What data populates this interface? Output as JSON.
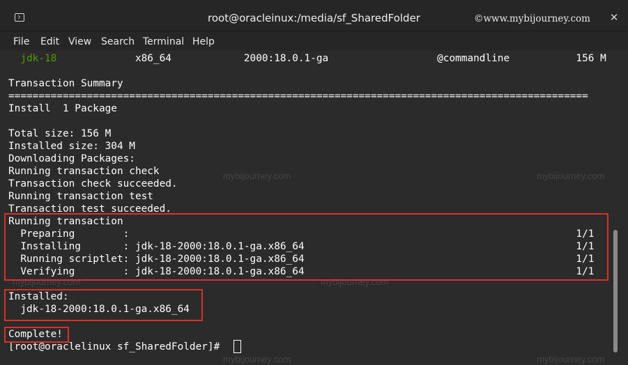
{
  "window": {
    "title": "root@oracleinux:/media/sf_SharedFolder",
    "watermark": "©www.mybijourney.com"
  },
  "menu": [
    "File",
    "Edit",
    "View",
    "Search",
    "Terminal",
    "Help"
  ],
  "terminal": {
    "lines": [
      "  jdk-18             x86_64            2000:18.0.1-ga                  @commandline           156 M",
      "",
      "Transaction Summary",
      "================================================================================================",
      "Install  1 Package",
      "",
      "Total size: 156 M",
      "Installed size: 304 M",
      "Downloading Packages:",
      "Running transaction check",
      "Transaction check succeeded.",
      "Running transaction test",
      "Transaction test succeeded.",
      "Running transaction",
      "  Preparing        :                                                                          1/1",
      "  Installing       : jdk-18-2000:18.0.1-ga.x86_64                                             1/1",
      "  Running scriptlet: jdk-18-2000:18.0.1-ga.x86_64                                             1/1",
      "  Verifying        : jdk-18-2000:18.0.1-ga.x86_64                                             1/1",
      "",
      "Installed:",
      "  jdk-18-2000:18.0.1-ga.x86_64",
      "",
      "Complete!",
      "[root@oraclelinux sf_SharedFolder]# "
    ],
    "first_line_pkg": "jdk-18",
    "first_line_rest": "             x86_64            2000:18.0.1-ga                  @commandline           156 M"
  },
  "watermarks": [
    "mybijourney.com",
    "mybijourney.com",
    "mybijourney.com",
    "mybijourney.com",
    "mybijourney.com",
    "mybijourney.com"
  ],
  "colors": {
    "background": "#2b2b2b",
    "text": "#ffffff",
    "package_green": "#4e9a06",
    "highlight_box": "#d9312a"
  }
}
